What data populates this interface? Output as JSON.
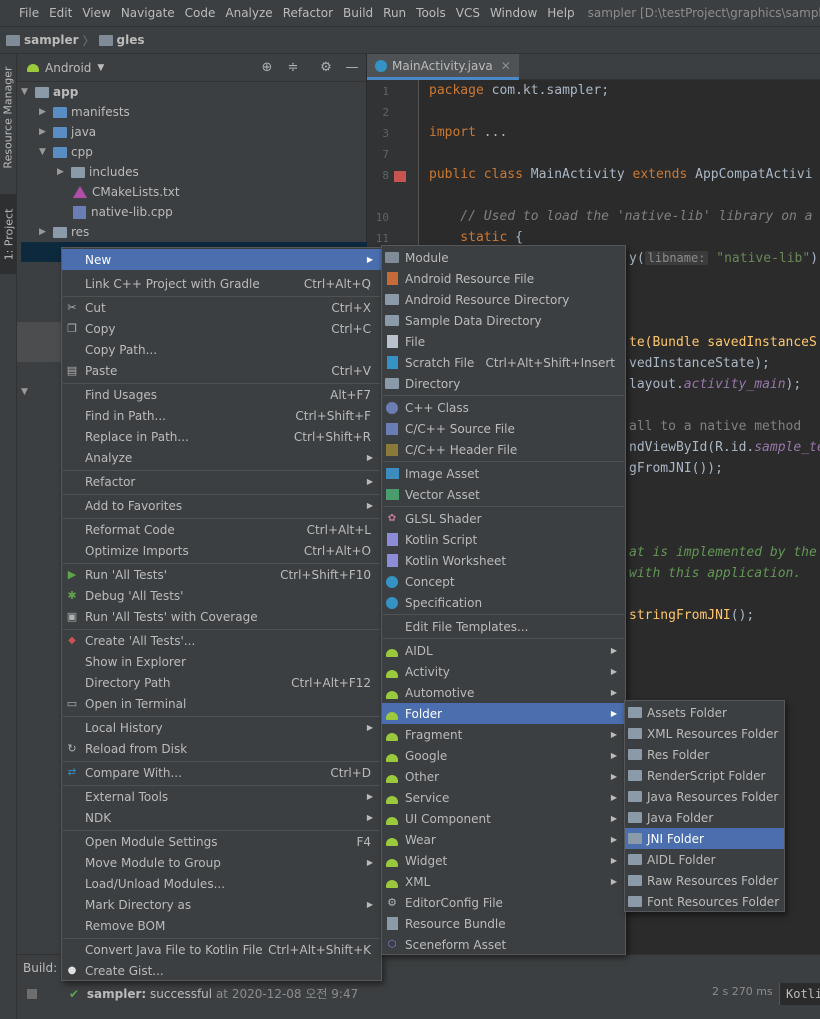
{
  "menubar": {
    "items": [
      "File",
      "Edit",
      "View",
      "Navigate",
      "Code",
      "Analyze",
      "Refactor",
      "Build",
      "Run",
      "Tools",
      "VCS",
      "Window",
      "Help"
    ],
    "title": "sampler [D:\\testProject\\graphics\\sampler"
  },
  "navbar": {
    "project": "sampler",
    "module": "gles"
  },
  "sidestrip": {
    "resource_manager": "Resource Manager",
    "project": "1: Project"
  },
  "project_panel": {
    "view": "Android",
    "tree": [
      {
        "label": "app",
        "icon": "folder-icon"
      },
      {
        "label": "manifests",
        "icon": "folder-icon"
      },
      {
        "label": "java",
        "icon": "folder-icon"
      },
      {
        "label": "cpp",
        "icon": "folder-icon"
      },
      {
        "label": "includes",
        "icon": "folder-icon"
      },
      {
        "label": "CMakeLists.txt",
        "icon": "cmake-icon"
      },
      {
        "label": "native-lib.cpp",
        "icon": "cpp-file-icon"
      },
      {
        "label": "res",
        "icon": "folder-icon"
      }
    ]
  },
  "editor": {
    "tab": "MainActivity.java",
    "lines": [
      1,
      2,
      3,
      7,
      8,
      10,
      11
    ],
    "code": {
      "l1_kw": "package",
      "l1_rest": " com.kt.sampler;",
      "l3_kw": "import",
      "l3_rest": " ...",
      "l8_kw1": "public class",
      "l8_name": " MainActivity ",
      "l8_kw2": "extends",
      "l8_rest": " AppCompatActivi",
      "l10": "    // Used to load the 'native-lib' library on a",
      "l11_kw": "    static",
      "l11_rest": " {",
      "l12_fn": "y(",
      "l12_hint": "libname:",
      "l12_str": " \"native-lib\"",
      "l12_end": ");",
      "l16": "te(Bundle savedInstanceS",
      "l17": "vedInstanceState);",
      "l18_a": "layout.",
      "l18_b": "activity_main",
      "l18_c": ");",
      "l20": "all to a native method",
      "l21_a": "ndViewById(R.id.",
      "l21_b": "sample_te",
      "l22": "gFromJNI());",
      "l26": "at is implemented by the",
      "l27": "with this application.",
      "l29_a": "stringFromJNI",
      "l29_b": "();"
    }
  },
  "context_menu": {
    "items": [
      {
        "label": "New",
        "sub": true
      },
      {
        "label": "Link C++ Project with Gradle",
        "shortcut": "Ctrl+Alt+Q"
      },
      {
        "label": "Cut",
        "shortcut": "Ctrl+X",
        "icon": "cut-icon"
      },
      {
        "label": "Copy",
        "shortcut": "Ctrl+C",
        "icon": "copy-icon"
      },
      {
        "label": "Copy Path...",
        "shortcut": ""
      },
      {
        "label": "Paste",
        "shortcut": "Ctrl+V",
        "icon": "paste-icon"
      },
      {
        "label": "Find Usages",
        "shortcut": "Alt+F7"
      },
      {
        "label": "Find in Path...",
        "shortcut": "Ctrl+Shift+F"
      },
      {
        "label": "Replace in Path...",
        "shortcut": "Ctrl+Shift+R"
      },
      {
        "label": "Analyze",
        "sub": true
      },
      {
        "label": "Refactor",
        "sub": true
      },
      {
        "label": "Add to Favorites",
        "sub": true
      },
      {
        "label": "Reformat Code",
        "shortcut": "Ctrl+Alt+L"
      },
      {
        "label": "Optimize Imports",
        "shortcut": "Ctrl+Alt+O"
      },
      {
        "label": "Run 'All Tests'",
        "shortcut": "Ctrl+Shift+F10",
        "icon": "run-icon"
      },
      {
        "label": "Debug 'All Tests'",
        "shortcut": "",
        "icon": "debug-icon"
      },
      {
        "label": "Run 'All Tests' with Coverage",
        "shortcut": "",
        "icon": "coverage-icon"
      },
      {
        "label": "Create 'All Tests'...",
        "shortcut": "",
        "icon": "create-test-icon"
      },
      {
        "label": "Show in Explorer",
        "shortcut": ""
      },
      {
        "label": "Directory Path",
        "shortcut": "Ctrl+Alt+F12"
      },
      {
        "label": "Open in Terminal",
        "shortcut": "",
        "icon": "terminal-icon"
      },
      {
        "label": "Local History",
        "sub": true
      },
      {
        "label": "Reload from Disk",
        "shortcut": "",
        "icon": "reload-icon"
      },
      {
        "label": "Compare With...",
        "shortcut": "Ctrl+D",
        "icon": "compare-icon"
      },
      {
        "label": "External Tools",
        "sub": true
      },
      {
        "label": "NDK",
        "sub": true
      },
      {
        "label": "Open Module Settings",
        "shortcut": "F4"
      },
      {
        "label": "Move Module to Group",
        "sub": true
      },
      {
        "label": "Load/Unload Modules...",
        "shortcut": ""
      },
      {
        "label": "Mark Directory as",
        "sub": true
      },
      {
        "label": "Remove BOM",
        "shortcut": ""
      },
      {
        "label": "Convert Java File to Kotlin File",
        "shortcut": "Ctrl+Alt+Shift+K"
      },
      {
        "label": "Create Gist...",
        "shortcut": "",
        "icon": "github-icon"
      }
    ]
  },
  "new_menu": {
    "items": [
      {
        "label": "Module",
        "icon": "module-icon"
      },
      {
        "label": "Android Resource File",
        "icon": "resource-file-icon"
      },
      {
        "label": "Android Resource Directory",
        "icon": "folder-icon"
      },
      {
        "label": "Sample Data Directory",
        "icon": "folder-icon"
      },
      {
        "label": "File",
        "icon": "file-icon"
      },
      {
        "label": "Scratch File",
        "shortcut": "Ctrl+Alt+Shift+Insert",
        "icon": "scratch-file-icon"
      },
      {
        "label": "Directory",
        "icon": "folder-icon"
      },
      {
        "label": "C++ Class",
        "icon": "cpp-class-icon"
      },
      {
        "label": "C/C++ Source File",
        "icon": "cpp-source-icon"
      },
      {
        "label": "C/C++ Header File",
        "icon": "cpp-header-icon"
      },
      {
        "label": "Image Asset",
        "icon": "image-asset-icon"
      },
      {
        "label": "Vector Asset",
        "icon": "vector-asset-icon"
      },
      {
        "label": "GLSL Shader",
        "icon": "glsl-icon"
      },
      {
        "label": "Kotlin Script",
        "icon": "kotlin-icon"
      },
      {
        "label": "Kotlin Worksheet",
        "icon": "kotlin-icon"
      },
      {
        "label": "Concept",
        "icon": "concept-icon"
      },
      {
        "label": "Specification",
        "icon": "specification-icon"
      },
      {
        "label": "Edit File Templates..."
      },
      {
        "label": "AIDL",
        "sub": true,
        "icon": "android-icon"
      },
      {
        "label": "Activity",
        "sub": true,
        "icon": "android-icon"
      },
      {
        "label": "Automotive",
        "sub": true,
        "icon": "android-icon"
      },
      {
        "label": "Folder",
        "sub": true,
        "icon": "android-icon"
      },
      {
        "label": "Fragment",
        "sub": true,
        "icon": "android-icon"
      },
      {
        "label": "Google",
        "sub": true,
        "icon": "android-icon"
      },
      {
        "label": "Other",
        "sub": true,
        "icon": "android-icon"
      },
      {
        "label": "Service",
        "sub": true,
        "icon": "android-icon"
      },
      {
        "label": "UI Component",
        "sub": true,
        "icon": "android-icon"
      },
      {
        "label": "Wear",
        "sub": true,
        "icon": "android-icon"
      },
      {
        "label": "Widget",
        "sub": true,
        "icon": "android-icon"
      },
      {
        "label": "XML",
        "sub": true,
        "icon": "android-icon"
      },
      {
        "label": "EditorConfig File",
        "icon": "gear-icon"
      },
      {
        "label": "Resource Bundle",
        "icon": "resource-bundle-icon"
      },
      {
        "label": "Sceneform Asset",
        "icon": "sceneform-icon"
      }
    ]
  },
  "folder_menu": {
    "items": [
      {
        "label": "Assets Folder"
      },
      {
        "label": "XML Resources Folder"
      },
      {
        "label": "Res Folder"
      },
      {
        "label": "RenderScript Folder"
      },
      {
        "label": "Java Resources Folder"
      },
      {
        "label": "Java Folder"
      },
      {
        "label": "JNI Folder"
      },
      {
        "label": "AIDL Folder"
      },
      {
        "label": "Raw Resources Folder"
      },
      {
        "label": "Font Resources Folder"
      }
    ]
  },
  "build": {
    "label": "Build:",
    "project": "sampler:",
    "status": " successful",
    "time_prefix": " at ",
    "time": "2020-12-08 오전 9:47",
    "duration": "2 s 270 ms",
    "console": "Kotli"
  },
  "colors": {
    "selection": "#4b6eaf",
    "android_green": "#9aca3c",
    "background": "#2b2b2b",
    "panel": "#3c3f41"
  }
}
